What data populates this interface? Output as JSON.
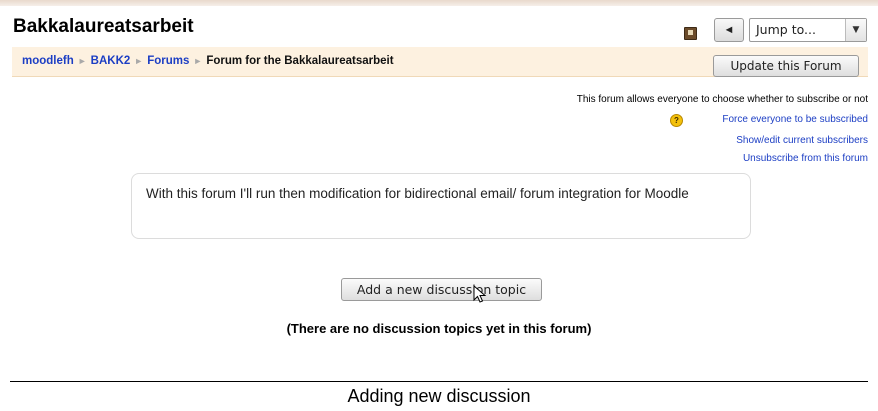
{
  "header": {
    "title": "Bakkalaureatsarbeit",
    "prev_label": "◄",
    "jump": {
      "selected": "Jump to..."
    }
  },
  "breadcrumb": {
    "items": [
      "moodlefh",
      "BAKK2",
      "Forums"
    ],
    "current": "Forum for the Bakkalaureatsarbeit"
  },
  "update_button": "Update this Forum",
  "subscription": {
    "info": "This forum allows everyone to choose whether to subscribe or not",
    "force": "Force everyone to be subscribed",
    "show_edit": "Show/edit current subscribers",
    "unsubscribe": "Unsubscribe from this forum"
  },
  "intro": "With this forum I'll run then modification for bidirectional email/ forum integration for Moodle",
  "add_button": "Add a new discussion topic",
  "no_topics": "(There are no discussion topics yet in this forum)",
  "caption": "Adding new discussion",
  "colors": {
    "link": "#1c3ec4",
    "navbar_bg": "#fdf1e0",
    "accent_top": "#e9d9cc"
  },
  "icons": {
    "home": "book-icon",
    "help": "help-icon",
    "cursor": "mouse-pointer-icon"
  }
}
